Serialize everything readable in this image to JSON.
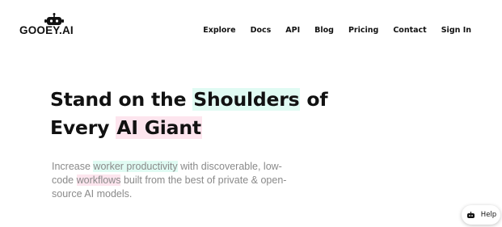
{
  "brand": {
    "name": "GOOEY.AI",
    "logo_icon": "robot-icon"
  },
  "nav": {
    "items": [
      {
        "label": "Explore"
      },
      {
        "label": "Docs"
      },
      {
        "label": "API"
      },
      {
        "label": "Blog"
      },
      {
        "label": "Pricing"
      },
      {
        "label": "Contact"
      },
      {
        "label": "Sign In"
      }
    ]
  },
  "hero": {
    "headline_part1": "Stand on the ",
    "headline_highlight1": "Shoulders",
    "headline_part2": " of",
    "headline_part3": "Every ",
    "headline_highlight2": "AI Giant",
    "desc_part1": "Increase ",
    "desc_highlight1": "worker productivity",
    "desc_part2": " with discoverable, low-code ",
    "desc_highlight2": "workflows",
    "desc_part3": " built from the best of private & open-source AI models."
  },
  "help": {
    "label": "Help",
    "icon": "robot-icon"
  },
  "colors": {
    "highlight_green": "#e0fbf3",
    "highlight_pink": "#fde5ee",
    "text": "#111111",
    "muted": "#8a8a8a"
  }
}
